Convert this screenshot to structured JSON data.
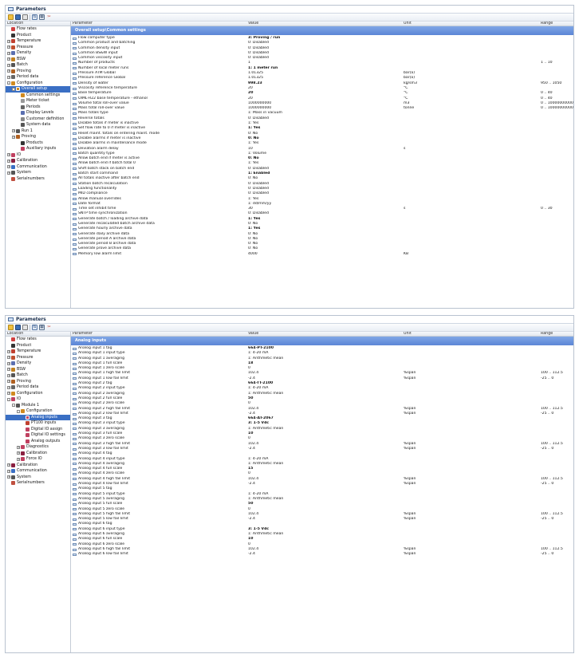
{
  "window_title": "Parameters",
  "toolbar_icons": [
    "open-folder-icon",
    "save-icon",
    "print-icon",
    "export-icon",
    "grid-icon",
    "tools-icon"
  ],
  "tree_header": "Location",
  "columns": {
    "parameter": "Parameter",
    "value": "Value",
    "unit": "Unit",
    "range": "Range"
  },
  "panel1": {
    "tree": [
      {
        "label": "Flow rates",
        "depth": 0,
        "exp": "",
        "icon": "flow-rates-icon",
        "color": "#d04040"
      },
      {
        "label": "Product",
        "depth": 0,
        "exp": "",
        "icon": "product-icon",
        "color": "#333"
      },
      {
        "label": "Temperature",
        "depth": 0,
        "exp": "+",
        "icon": "temperature-icon",
        "color": "#c04030"
      },
      {
        "label": "Pressure",
        "depth": 0,
        "exp": "+",
        "icon": "pressure-icon",
        "color": "#c05030"
      },
      {
        "label": "Density",
        "depth": 0,
        "exp": "+",
        "icon": "density-icon",
        "color": "#5a6fb0"
      },
      {
        "label": "BSW",
        "depth": 0,
        "exp": "+",
        "icon": "bsw-icon",
        "color": "#c08020"
      },
      {
        "label": "Batch",
        "depth": 0,
        "exp": "+",
        "icon": "batch-icon",
        "color": "#555"
      },
      {
        "label": "Proving",
        "depth": 0,
        "exp": "+",
        "icon": "proving-icon",
        "color": "#b06020"
      },
      {
        "label": "Period data",
        "depth": 0,
        "exp": "+",
        "icon": "period-data-icon",
        "color": "#666"
      },
      {
        "label": "Configuration",
        "depth": 0,
        "exp": "-",
        "icon": "configuration-icon",
        "color": "#d08a20"
      },
      {
        "label": "Overall setup",
        "depth": 1,
        "exp": "-",
        "icon": "overall-setup-icon",
        "color": "#d08a20",
        "selected": true
      },
      {
        "label": "Common settings",
        "depth": 2,
        "exp": "",
        "icon": "common-settings-icon",
        "color": "#d08a20"
      },
      {
        "label": "Meter ticket",
        "depth": 2,
        "exp": "",
        "icon": "meter-ticket-icon",
        "color": "#999"
      },
      {
        "label": "Periods",
        "depth": 2,
        "exp": "",
        "icon": "periods-icon",
        "color": "#666"
      },
      {
        "label": "Display Levels",
        "depth": 2,
        "exp": "",
        "icon": "display-levels-icon",
        "color": "#5a6fb0"
      },
      {
        "label": "Customer definition",
        "depth": 2,
        "exp": "",
        "icon": "customer-definition-icon",
        "color": "#888"
      },
      {
        "label": "System data",
        "depth": 2,
        "exp": "",
        "icon": "system-data-icon",
        "color": "#555"
      },
      {
        "label": "Run 1",
        "depth": 1,
        "exp": "+",
        "icon": "run-icon",
        "color": "#555"
      },
      {
        "label": "Proving",
        "depth": 1,
        "exp": "+",
        "icon": "proving-icon",
        "color": "#b06020"
      },
      {
        "label": "Products",
        "depth": 2,
        "exp": "",
        "icon": "products-icon",
        "color": "#333"
      },
      {
        "label": "Auxiliary inputs",
        "depth": 2,
        "exp": "",
        "icon": "auxiliary-inputs-icon",
        "color": "#c04060"
      },
      {
        "label": "IO",
        "depth": 0,
        "exp": "+",
        "icon": "io-icon",
        "color": "#c04060"
      },
      {
        "label": "Calibration",
        "depth": 0,
        "exp": "+",
        "icon": "calibration-icon",
        "color": "#8a2040"
      },
      {
        "label": "Communication",
        "depth": 0,
        "exp": "+",
        "icon": "communication-icon",
        "color": "#3a6fc4"
      },
      {
        "label": "System",
        "depth": 0,
        "exp": "+",
        "icon": "system-icon",
        "color": "#555"
      },
      {
        "label": "Serialnumbers",
        "depth": 0,
        "exp": "",
        "icon": "serialnumbers-icon",
        "color": "#c05040"
      }
    ],
    "section": "Overall setup\\Common settings",
    "rows": [
      {
        "p": "Flow computer type",
        "v": "3: Proving / run",
        "u": "",
        "r": "",
        "b": true
      },
      {
        "p": "Common product and batching",
        "v": "0: Disabled",
        "u": "",
        "r": ""
      },
      {
        "p": "Common density input",
        "v": "0: Disabled",
        "u": "",
        "r": ""
      },
      {
        "p": "Common BS&W input",
        "v": "0: Disabled",
        "u": "",
        "r": ""
      },
      {
        "p": "Common viscosity input",
        "v": "0: Disabled",
        "u": "",
        "r": ""
      },
      {
        "p": "Number of products",
        "v": "1",
        "u": "",
        "r": "1 .. 10"
      },
      {
        "p": "Number of local meter runs",
        "v": "1: 1 meter run",
        "u": "",
        "r": "",
        "b": true
      },
      {
        "p": "Pressure ATM Global",
        "v": "1.01325",
        "u": "bar(a)",
        "r": ""
      },
      {
        "p": "Pressure reference Global",
        "v": "1.01325",
        "u": "bar(a)",
        "r": ""
      },
      {
        "p": "Density of water",
        "v": "998.23",
        "u": "kg/sm3",
        "r": "950 .. 1050",
        "b": true
      },
      {
        "p": "Viscosity reference temperature",
        "v": "20",
        "u": "°C",
        "r": ""
      },
      {
        "p": "Base temperature",
        "v": "20",
        "u": "°C",
        "r": "0 .. 40",
        "b": true
      },
      {
        "p": "OIML-R22 base temperature - ethanol",
        "v": "20",
        "u": "°C",
        "r": "0 .. 40"
      },
      {
        "p": "Volume total roll-over value",
        "v": "1000000000",
        "u": "m3",
        "r": "0 .. 10000000000000"
      },
      {
        "p": "Mass total roll-over value",
        "v": "1000000000",
        "u": "tonne",
        "r": "0 .. 10000000000000"
      },
      {
        "p": "Mass totals type",
        "v": "1: Mass in vacuum",
        "u": "",
        "r": ""
      },
      {
        "p": "Reverse totals",
        "v": "0: Disabled",
        "u": "",
        "r": ""
      },
      {
        "p": "Disable totals if meter is inactive",
        "v": "1: Yes",
        "u": "",
        "r": ""
      },
      {
        "p": "Set flow rate to 0 if meter is inactive",
        "v": "1: Yes",
        "u": "",
        "r": "",
        "b": true
      },
      {
        "p": "Reset maint. totals on entering maint. mode",
        "v": "0: No",
        "u": "",
        "r": ""
      },
      {
        "p": "Disable alarms if meter is inactive",
        "v": "0: No",
        "u": "",
        "r": "",
        "b": true
      },
      {
        "p": "Disable alarms in maintenance mode",
        "v": "1: Yes",
        "u": "",
        "r": ""
      },
      {
        "p": "Deviation alarm delay",
        "v": "10",
        "u": "s",
        "r": ""
      },
      {
        "p": "Batch quantity type",
        "v": "1: Volume",
        "u": "",
        "r": ""
      },
      {
        "p": "Allow batch end if meter is active",
        "v": "0: No",
        "u": "",
        "r": "",
        "b": true
      },
      {
        "p": "Allow batch end if batch total 0",
        "v": "1: Yes",
        "u": "",
        "r": ""
      },
      {
        "p": "Shift batch stack on batch end",
        "v": "0: Disabled",
        "u": "",
        "r": ""
      },
      {
        "p": "Batch start command",
        "v": "1: Enabled",
        "u": "",
        "r": "",
        "b": true
      },
      {
        "p": "All totals inactive after batch end",
        "v": "0: No",
        "u": "",
        "r": ""
      },
      {
        "p": "Station batch recalculation",
        "v": "0: Disabled",
        "u": "",
        "r": ""
      },
      {
        "p": "Loading functionality",
        "v": "0: Disabled",
        "u": "",
        "r": ""
      },
      {
        "p": "MID compliance",
        "v": "0: Disabled",
        "u": "",
        "r": ""
      },
      {
        "p": "Allow manual overrides",
        "v": "1: Yes",
        "u": "",
        "r": ""
      },
      {
        "p": "Date format",
        "v": "1: dd/mm/yy",
        "u": "",
        "r": ""
      },
      {
        "p": "Time set inhibit time",
        "v": "30",
        "u": "s",
        "r": "0 .. 30"
      },
      {
        "p": "SNTP time synchronization",
        "v": "0: Disabled",
        "u": "",
        "r": ""
      },
      {
        "p": "Generate batch / loading archive data",
        "v": "1: Yes",
        "u": "",
        "r": "",
        "b": true
      },
      {
        "p": "Generate recalculated batch archive data",
        "v": "0: No",
        "u": "",
        "r": ""
      },
      {
        "p": "Generate hourly archive data",
        "v": "1: Yes",
        "u": "",
        "r": "",
        "b": true
      },
      {
        "p": "Generate daily archive data",
        "v": "0: No",
        "u": "",
        "r": ""
      },
      {
        "p": "Generate period A archive data",
        "v": "0: No",
        "u": "",
        "r": ""
      },
      {
        "p": "Generate period B archive data",
        "v": "0: No",
        "u": "",
        "r": ""
      },
      {
        "p": "Generate prove archive data",
        "v": "0: No",
        "u": "",
        "r": ""
      },
      {
        "p": "Memory low alarm limit",
        "v": "4000",
        "u": "KB",
        "r": ""
      }
    ]
  },
  "panel2": {
    "tree": [
      {
        "label": "Flow rates",
        "depth": 0,
        "exp": "",
        "icon": "flow-rates-icon",
        "color": "#d04040"
      },
      {
        "label": "Product",
        "depth": 0,
        "exp": "",
        "icon": "product-icon",
        "color": "#333"
      },
      {
        "label": "Temperature",
        "depth": 0,
        "exp": "+",
        "icon": "temperature-icon",
        "color": "#c04030"
      },
      {
        "label": "Pressure",
        "depth": 0,
        "exp": "+",
        "icon": "pressure-icon",
        "color": "#c05030"
      },
      {
        "label": "Density",
        "depth": 0,
        "exp": "+",
        "icon": "density-icon",
        "color": "#5a6fb0"
      },
      {
        "label": "BSW",
        "depth": 0,
        "exp": "+",
        "icon": "bsw-icon",
        "color": "#c08020"
      },
      {
        "label": "Batch",
        "depth": 0,
        "exp": "+",
        "icon": "batch-icon",
        "color": "#555"
      },
      {
        "label": "Proving",
        "depth": 0,
        "exp": "+",
        "icon": "proving-icon",
        "color": "#b06020"
      },
      {
        "label": "Period data",
        "depth": 0,
        "exp": "+",
        "icon": "period-data-icon",
        "color": "#666"
      },
      {
        "label": "Configuration",
        "depth": 0,
        "exp": "+",
        "icon": "configuration-icon",
        "color": "#d08a20"
      },
      {
        "label": "IO",
        "depth": 0,
        "exp": "-",
        "icon": "io-icon",
        "color": "#c04060"
      },
      {
        "label": "Module 1",
        "depth": 1,
        "exp": "-",
        "icon": "module-icon",
        "color": "#555"
      },
      {
        "label": "Configuration",
        "depth": 2,
        "exp": "-",
        "icon": "configuration-icon",
        "color": "#d08a20"
      },
      {
        "label": "Analog inputs",
        "depth": 3,
        "exp": "",
        "icon": "analog-inputs-icon",
        "color": "#c04060",
        "selected": true
      },
      {
        "label": "PT100 inputs",
        "depth": 3,
        "exp": "",
        "icon": "pt100-inputs-icon",
        "color": "#c04030"
      },
      {
        "label": "Digital IO assign",
        "depth": 3,
        "exp": "",
        "icon": "digital-io-assign-icon",
        "color": "#c04060"
      },
      {
        "label": "Digital IO settings",
        "depth": 3,
        "exp": "",
        "icon": "digital-io-settings-icon",
        "color": "#c04060"
      },
      {
        "label": "Analog outputs",
        "depth": 3,
        "exp": "",
        "icon": "analog-outputs-icon",
        "color": "#c04060"
      },
      {
        "label": "Diagnostics",
        "depth": 2,
        "exp": "+",
        "icon": "diagnostics-icon",
        "color": "#c04060"
      },
      {
        "label": "Calibration",
        "depth": 2,
        "exp": "+",
        "icon": "calibration-icon",
        "color": "#8a2040"
      },
      {
        "label": "Force IO",
        "depth": 2,
        "exp": "+",
        "icon": "force-io-icon",
        "color": "#c04060"
      },
      {
        "label": "Calibration",
        "depth": 0,
        "exp": "+",
        "icon": "calibration-icon",
        "color": "#8a2040"
      },
      {
        "label": "Communication",
        "depth": 0,
        "exp": "+",
        "icon": "communication-icon",
        "color": "#3a6fc4"
      },
      {
        "label": "System",
        "depth": 0,
        "exp": "+",
        "icon": "system-icon",
        "color": "#555"
      },
      {
        "label": "Serialnumbers",
        "depth": 0,
        "exp": "",
        "icon": "serialnumbers-icon",
        "color": "#c05040"
      }
    ],
    "section": "Analog inputs",
    "rows": [
      {
        "p": "Analog input 1 tag",
        "v": "664-PT-2100",
        "u": "",
        "r": "",
        "b": true
      },
      {
        "p": "Analog input 1 input type",
        "v": "1: 4-20 mA",
        "u": "",
        "r": ""
      },
      {
        "p": "Analog input 1 averaging",
        "v": "1: Arithmetic mean",
        "u": "",
        "r": ""
      },
      {
        "p": "Analog input 1 full scale",
        "v": "18",
        "u": "",
        "r": "",
        "b": true
      },
      {
        "p": "Analog input 1 zero scale",
        "v": "0",
        "u": "",
        "r": ""
      },
      {
        "p": "Analog input 1 high fail limit",
        "v": "102.4",
        "u": "%span",
        "r": "100 .. 112.5"
      },
      {
        "p": "Analog input 1 low fail limit",
        "v": "-2.4",
        "u": "%span",
        "r": "-25 .. 0"
      },
      {
        "p": "Analog input 2 tag",
        "v": "664-TT-2100",
        "u": "",
        "r": "",
        "b": true
      },
      {
        "p": "Analog input 2 input type",
        "v": "1: 4-20 mA",
        "u": "",
        "r": ""
      },
      {
        "p": "Analog input 2 averaging",
        "v": "1: Arithmetic mean",
        "u": "",
        "r": ""
      },
      {
        "p": "Analog input 2 full scale",
        "v": "50",
        "u": "",
        "r": "",
        "b": true
      },
      {
        "p": "Analog input 2 zero scale",
        "v": "0",
        "u": "",
        "r": ""
      },
      {
        "p": "Analog input 2 high fail limit",
        "v": "102.4",
        "u": "%span",
        "r": "100 .. 112.5"
      },
      {
        "p": "Analog input 2 low fail limit",
        "v": "-2.4",
        "u": "%span",
        "r": "-25 .. 0"
      },
      {
        "p": "Analog input 3 tag",
        "v": "664-AT-2067",
        "u": "",
        "r": "",
        "b": true
      },
      {
        "p": "Analog input 3 input type",
        "v": "3: 1-5 Vdc",
        "u": "",
        "r": "",
        "b": true
      },
      {
        "p": "Analog input 3 averaging",
        "v": "1: Arithmetic mean",
        "u": "",
        "r": ""
      },
      {
        "p": "Analog input 3 full scale",
        "v": "10",
        "u": "",
        "r": "",
        "b": true
      },
      {
        "p": "Analog input 3 zero scale",
        "v": "0",
        "u": "",
        "r": ""
      },
      {
        "p": "Analog input 3 high fail limit",
        "v": "102.4",
        "u": "%span",
        "r": "100 .. 112.5"
      },
      {
        "p": "Analog input 3 low fail limit",
        "v": "-2.4",
        "u": "%span",
        "r": "-25 .. 0"
      },
      {
        "p": "Analog input 4 tag",
        "v": "",
        "u": "",
        "r": ""
      },
      {
        "p": "Analog input 4 input type",
        "v": "1: 4-20 mA",
        "u": "",
        "r": ""
      },
      {
        "p": "Analog input 4 averaging",
        "v": "1: Arithmetic mean",
        "u": "",
        "r": ""
      },
      {
        "p": "Analog input 4 full scale",
        "v": "15",
        "u": "",
        "r": "",
        "b": true
      },
      {
        "p": "Analog input 4 zero scale",
        "v": "0",
        "u": "",
        "r": ""
      },
      {
        "p": "Analog input 4 high fail limit",
        "v": "102.4",
        "u": "%span",
        "r": "100 .. 112.5"
      },
      {
        "p": "Analog input 4 low fail limit",
        "v": "-2.4",
        "u": "%span",
        "r": "-25 .. 0"
      },
      {
        "p": "Analog input 5 tag",
        "v": "",
        "u": "",
        "r": ""
      },
      {
        "p": "Analog input 5 input type",
        "v": "1: 4-20 mA",
        "u": "",
        "r": ""
      },
      {
        "p": "Analog input 5 averaging",
        "v": "1: Arithmetic mean",
        "u": "",
        "r": ""
      },
      {
        "p": "Analog input 5 full scale",
        "v": "50",
        "u": "",
        "r": "",
        "b": true
      },
      {
        "p": "Analog input 5 zero scale",
        "v": "0",
        "u": "",
        "r": ""
      },
      {
        "p": "Analog input 5 high fail limit",
        "v": "102.4",
        "u": "%span",
        "r": "100 .. 112.5"
      },
      {
        "p": "Analog input 5 low fail limit",
        "v": "-2.4",
        "u": "%span",
        "r": "-25 .. 0"
      },
      {
        "p": "Analog input 6 tag",
        "v": "",
        "u": "",
        "r": ""
      },
      {
        "p": "Analog input 6 input type",
        "v": "3: 1-5 Vdc",
        "u": "",
        "r": "",
        "b": true
      },
      {
        "p": "Analog input 6 averaging",
        "v": "1: Arithmetic mean",
        "u": "",
        "r": ""
      },
      {
        "p": "Analog input 6 full scale",
        "v": "10",
        "u": "",
        "r": "",
        "b": true
      },
      {
        "p": "Analog input 6 zero scale",
        "v": "0",
        "u": "",
        "r": ""
      },
      {
        "p": "Analog input 6 high fail limit",
        "v": "102.4",
        "u": "%span",
        "r": "100 .. 112.5"
      },
      {
        "p": "Analog input 6 low fail limit",
        "v": "-2.4",
        "u": "%span",
        "r": "-25 .. 0"
      }
    ]
  }
}
